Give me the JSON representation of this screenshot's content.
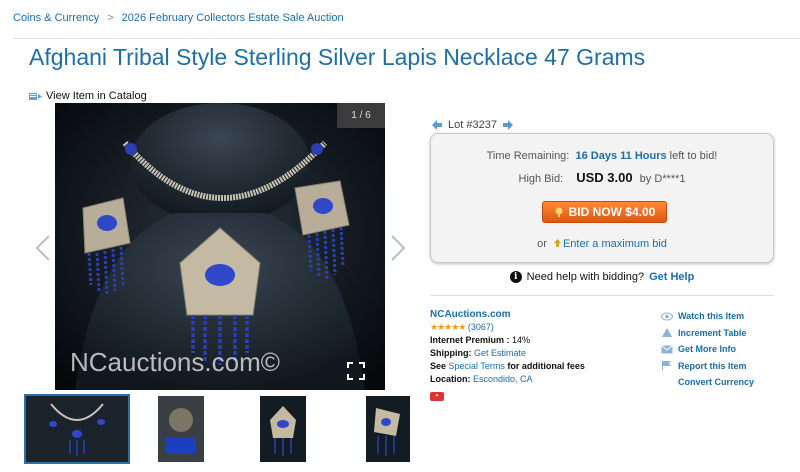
{
  "breadcrumb": {
    "item1": "Coins & Currency",
    "separator": ">",
    "item2": "2026 February Collectors Estate Sale Auction"
  },
  "title": "Afghani Tribal Style Sterling Silver Lapis Necklace 47 Grams",
  "catalog_link": "View Item in Catalog",
  "viewer": {
    "counter": "1 / 6",
    "watermark": "NCauctions.com©"
  },
  "lot": {
    "label": "Lot #3237"
  },
  "bid_box": {
    "time_label": "Time Remaining:",
    "time_value": "16 Days 11 Hours",
    "time_suffix": "left to bid!",
    "high_bid_label": "High Bid:",
    "high_bid_value": "USD 3.00",
    "high_bid_by": "by D****1",
    "bid_button": "BID NOW $4.00",
    "or_text": "or",
    "max_bid_link": "Enter a maximum bid"
  },
  "help": {
    "text": "Need help with bidding?",
    "link": "Get Help"
  },
  "seller": {
    "name": "NCAuctions.com",
    "stars": "★★★★★",
    "rating_count": "(3067)",
    "premium_label": "Internet Premium :",
    "premium_value": "14%",
    "shipping_label": "Shipping:",
    "shipping_link": "Get Estimate",
    "see_text": "See",
    "terms_link": "Special Terms",
    "terms_suffix": "for additional fees",
    "location_label": "Location:",
    "location_value": "Escondido, CA"
  },
  "actions": {
    "watch": "Watch this Item",
    "increment": "Increment Table",
    "info": "Get More Info",
    "report": "Report this Item",
    "currency": "Convert Currency"
  },
  "colors": {
    "link": "#1a6ea8",
    "bid_button": "#ee6a1c",
    "stars": "#f29a14",
    "lapis": "#2a3fb0"
  }
}
